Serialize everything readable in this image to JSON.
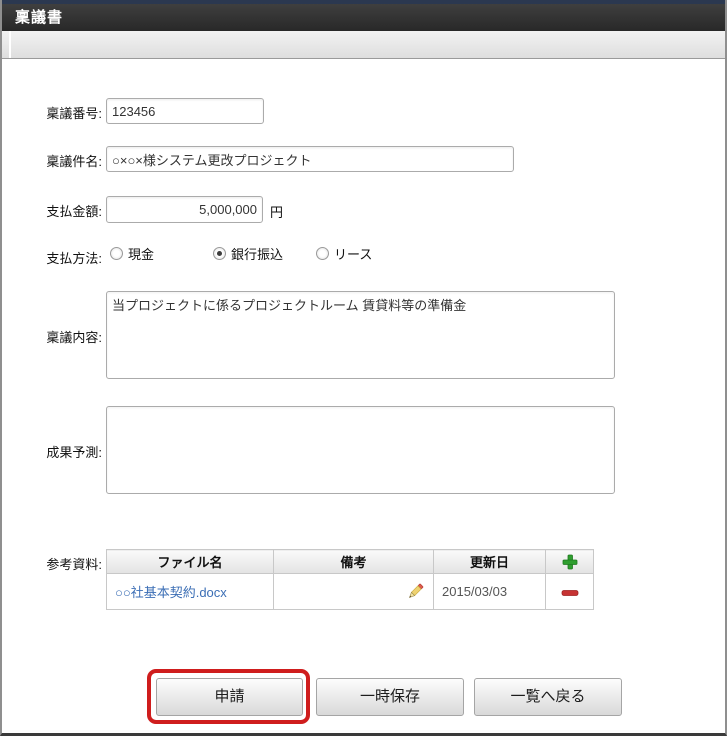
{
  "header": {
    "title": "稟議書"
  },
  "form": {
    "ringi_number": {
      "label": "稟議番号:",
      "value": "123456"
    },
    "ringi_title": {
      "label": "稟議件名:",
      "value": "○×○×様システム更改プロジェクト"
    },
    "payment_amount": {
      "label": "支払金額:",
      "value": "5,000,000",
      "unit": "円"
    },
    "payment_method": {
      "label": "支払方法:",
      "selected": "銀行振込",
      "options": [
        {
          "label": "現金",
          "checked": false
        },
        {
          "label": "銀行振込",
          "checked": true
        },
        {
          "label": "リース",
          "checked": false
        }
      ]
    },
    "ringi_content": {
      "label": "稟議内容:",
      "value": "当プロジェクトに係るプロジェクトルーム 賃貸料等の準備金"
    },
    "outcome_forecast": {
      "label": "成果予測:",
      "value": ""
    },
    "attachments": {
      "label": "参考資料:",
      "columns": [
        "ファイル名",
        "備考",
        "更新日"
      ],
      "rows": [
        {
          "file_name": "○○社基本契約.docx",
          "note": "",
          "updated": "2015/03/03"
        }
      ]
    }
  },
  "buttons": {
    "submit": "申請",
    "save_draft": "一時保存",
    "back_to_list": "一覧へ戻る"
  },
  "icons": {
    "add": "plus-icon",
    "remove": "minus-icon",
    "edit": "pencil-icon"
  },
  "colors": {
    "title_bar": "#333333",
    "top_line": "#2b3850",
    "link_blue": "#3b6eb5",
    "plus_green": "#2f9e2f",
    "minus_red": "#c63333",
    "annotation_red": "#cf1d1d"
  }
}
